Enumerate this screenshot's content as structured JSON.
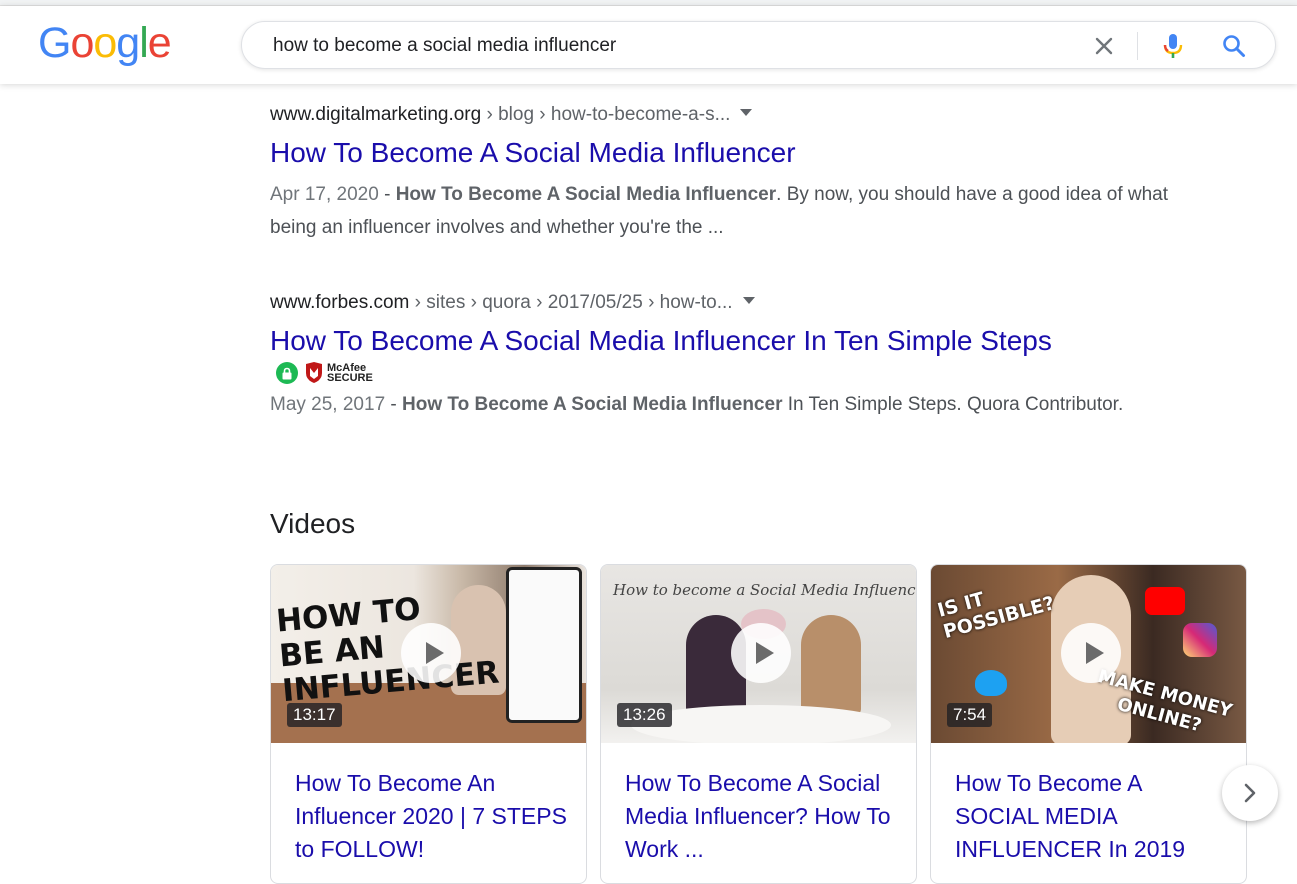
{
  "header": {
    "logo_letters": [
      {
        "char": "G",
        "color": "#4285F4"
      },
      {
        "char": "o",
        "color": "#EA4335"
      },
      {
        "char": "o",
        "color": "#FBBC05"
      },
      {
        "char": "g",
        "color": "#4285F4"
      },
      {
        "char": "l",
        "color": "#34A853"
      },
      {
        "char": "e",
        "color": "#EA4335"
      }
    ],
    "search_value": "how to become a social media influencer",
    "icons": {
      "clear": "close-icon",
      "mic": "microphone-icon",
      "search": "search-icon"
    }
  },
  "results": [
    {
      "site": "www.digitalmarketing.org",
      "crumbs": " › blog › how-to-become-a-s...",
      "title": "How To Become A Social Media Influencer",
      "date": "Apr 17, 2020",
      "sep": " - ",
      "bold": "How To Become A Social Media Influencer",
      "rest": ". By now, you should have a good idea of what being an influencer involves and whether you're the ..."
    },
    {
      "site": "www.forbes.com",
      "crumbs": " › sites › quora › 2017/05/25 › how-to...",
      "title": "How To Become A Social Media Influencer In Ten Simple Steps",
      "badge_line1": "McAfee",
      "badge_line2": "SECURE",
      "date": "May 25, 2017",
      "sep": " - ",
      "bold": "How To Become A Social Media Influencer",
      "rest": " In Ten Simple Steps. Quora Contributor."
    }
  ],
  "videos": {
    "heading": "Videos",
    "items": [
      {
        "duration": "13:17",
        "title": "How To Become An Influencer 2020 | 7 STEPS to FOLLOW!",
        "thumb_text": [
          "HOW TO",
          "BE AN",
          "INFLUENCER"
        ]
      },
      {
        "duration": "13:26",
        "title": "How To Become A Social Media Influencer? How To Work ...",
        "thumb_text": [
          "How to become a Social Media Influencer!"
        ]
      },
      {
        "duration": "7:54",
        "title": "How To Become A SOCIAL MEDIA INFLUENCER In 2019",
        "thumb_text": [
          "IS IT",
          "POSSIBLE?",
          "MAKE MONEY",
          "ONLINE?"
        ]
      }
    ],
    "next_icon": "chevron-right-icon"
  },
  "colors": {
    "link": "#1a0dab",
    "text": "#202124",
    "snippet": "#4d5156",
    "mcafee_red": "#c01818",
    "lock_green": "#1db954"
  }
}
